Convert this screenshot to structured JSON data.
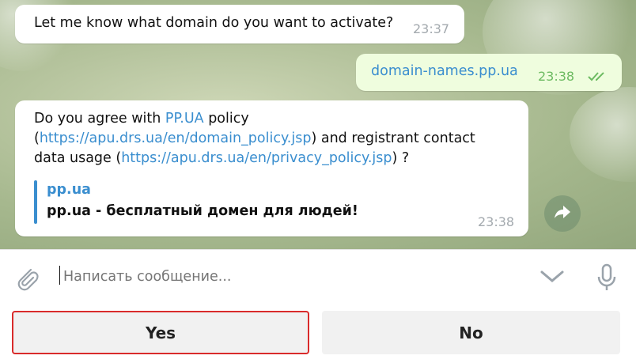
{
  "messages": [
    {
      "text": "Let me know what domain do you want to activate?",
      "time": "23:37"
    },
    {
      "text": "domain-names.pp.ua",
      "time": "23:38"
    },
    {
      "parts": {
        "intro": "Do you agree with ",
        "link1": "PP.UA",
        "mid1": " policy (",
        "link2": "https://apu.drs.ua/en/domain_policy.jsp",
        "mid2": ") and registrant contact data usage (",
        "link3": "https://apu.drs.ua/en/privacy_policy.jsp",
        "end": ") ?"
      },
      "preview_title": "pp.ua",
      "preview_desc": "pp.ua - бесплатный домен для людей!",
      "time": "23:38"
    }
  ],
  "composer": {
    "placeholder": "Написать сообщение..."
  },
  "keyboard": {
    "yes": "Yes",
    "no": "No"
  },
  "icons": {
    "read": "double-check-icon",
    "forward": "share-arrow-icon",
    "attach": "paperclip-icon",
    "collapse": "chevron-down-icon",
    "mic": "microphone-icon"
  },
  "colors": {
    "link": "#3a8ecf",
    "outgoing_bubble": "#effdde",
    "highlight": "#d92b2b"
  }
}
